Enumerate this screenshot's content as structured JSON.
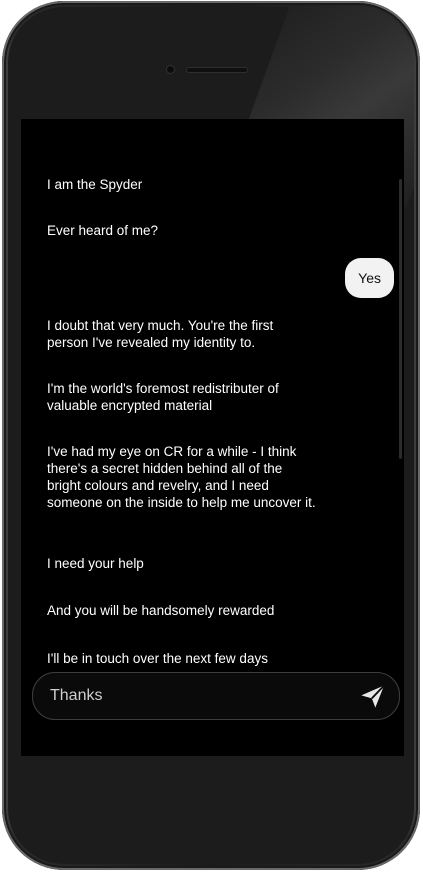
{
  "conversation": {
    "incoming": [
      {
        "text": "I am the Spyder"
      },
      {
        "text": "Ever heard of me?"
      },
      {
        "text": "I doubt that very much. You're the first person I've revealed my identity to."
      },
      {
        "text": "I'm the world's foremost redistributer of valuable encrypted material"
      },
      {
        "text": "I've had my eye on CR for a while - I think there's a secret hidden behind all of the bright colours and revelry, and I need someone on the inside to help me uncover it."
      },
      {
        "text": "I need your help"
      },
      {
        "text": "And you will be handsomely rewarded"
      },
      {
        "text": "I'll be in touch over the next few days"
      }
    ],
    "outgoing": [
      {
        "text": "Yes"
      }
    ]
  },
  "composer": {
    "value": "Thanks",
    "send_icon": "send-icon"
  },
  "colors": {
    "screen_background": "#000000",
    "incoming_text": "#ffffff",
    "outgoing_bubble": "#f2f2f2",
    "outgoing_text": "#111111",
    "phone_body": "#1c1c1c"
  }
}
